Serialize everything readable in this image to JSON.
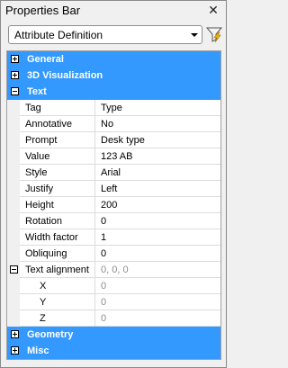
{
  "window": {
    "title": "Properties Bar",
    "close_glyph": "✕"
  },
  "selector": {
    "value": "Attribute Definition",
    "filter_icon": "filter-lightning-icon"
  },
  "categories": {
    "general": "General",
    "visualization": "3D Visualization",
    "text": "Text",
    "geometry": "Geometry",
    "misc": "Misc"
  },
  "text_props": [
    {
      "name": "Tag",
      "value": "Type"
    },
    {
      "name": "Annotative",
      "value": "No"
    },
    {
      "name": "Prompt",
      "value": "Desk type"
    },
    {
      "name": "Value",
      "value": "123 AB"
    },
    {
      "name": "Style",
      "value": "Arial"
    },
    {
      "name": "Justify",
      "value": "Left"
    },
    {
      "name": "Height",
      "value": "200"
    },
    {
      "name": "Rotation",
      "value": "0"
    },
    {
      "name": "Width factor",
      "value": "1"
    },
    {
      "name": "Obliquing",
      "value": "0"
    }
  ],
  "text_alignment": {
    "name": "Text alignment",
    "value": "0, 0, 0",
    "x": {
      "name": "X",
      "value": "0"
    },
    "y": {
      "name": "Y",
      "value": "0"
    },
    "z": {
      "name": "Z",
      "value": "0"
    }
  },
  "colors": {
    "category_bg": "#3399ff",
    "accent_filter": "#e8a000"
  }
}
